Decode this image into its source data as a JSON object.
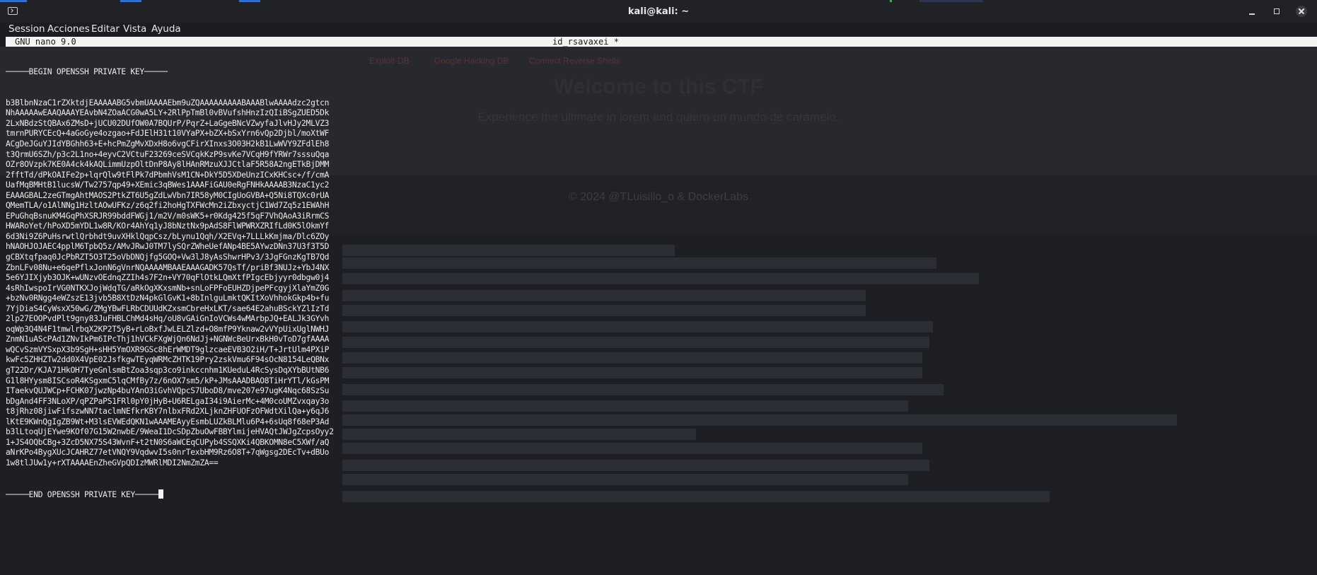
{
  "window": {
    "title": "kali@kali: ~"
  },
  "menu": [
    "Session",
    "Acciones",
    "Editar",
    "Vista",
    "Ayuda"
  ],
  "nano": {
    "version": "GNU nano 9.0",
    "filename": "id_rsavaxei *",
    "begin_line": "─────BEGIN OPENSSH PRIVATE KEY─────",
    "end_line": "─────END OPENSSH PRIVATE KEY─────",
    "key_lines": [
      "b3BlbnNzaC1rZXktdjEAAAAABG5vbmUAAAAEbm9uZQAAAAAAAAABAAABlwAAAAdzc2gtcn",
      "NhAAAAAwEAAQAAAYEAvbN4ZOaACG0wA5LY+2RlPpTmBl0vBVufshHnzIzQIiBSgZUED5Dk",
      "2LxNBdzStQBAx6ZMsD+jUCU02DUfOW0A7BQUrP/PqrZ+LaGgeBNcVZwyfaJlvHJy2MLVZ3",
      "tmrnPURYCEcQ+4aGoGye4ozgao+FdJElH31t10VYaPX+bZX+bSxYrn6vQp2Djbl/moXtWF",
      "ACgDeJGuYJIdYBGhh63+E+hcPmZgMvXDxH8o6vgCFirXInxs3O03H2kB1LwWVY9ZFdlEh8",
      "t3QrmU6SZh/p3c2L1no+4eyvC2VCtuF23269ceSVCqkKzP9svKe7VCqH9fYRWr7sssuQqa",
      "OZr8OVzpk7KE0A4ck4kAQLimmUzpOltDnP8Ay8lHAnRMzuXJJCtlaF5R58A2ngETkBjDMM",
      "2fftTd/dPkOAIFe2p+lqrQlw9tFlPk7dPbmhVsM1CN+DkY5D5XDeUnzICxKHCsc+/f/cmA",
      "UafMqBMHtB1lucsW/Tw2757qp49+XEmic3qBWes1AAAFiGAU0eRgFNHkAAAAB3NzaC1yc2",
      "EAAAGBAL2zeGTmgAhtMAOS2PtkZT6U5gZdLwVbn7IR58yM0CIgUoGVBA+Q5Ni8TQXc0rUA",
      "QMemTLA/o1AlNNg1HzltAOwUFKz/z6q2fi2hoHgTXFWcMn2iZbxyctjC1Wd7Zq5z1EWAhH",
      "EPuGhqBsnuKM4GqPhXSRJR99bddFWGj1/m2V/m0sWK5+r0Kdg425f5qF7VhQAoA3iRrmCS",
      "HWARoYet/hPoXD5mYDL1w8R/KOr4AhYq1yJ8bNztNx9pAdS8FlWPWRXZRIfLd0K5lOkmYf",
      "6d3Ni9Z6PuHsrwtlQrbhdt9uvXHklQqpCsz/bLynu1Qqh/X2EVq+7LLLkKmjma/Dlc6ZOy",
      "hNAOHJOJAEC4pplM6TpbQ5z/AMvJRwJ0TM7lySQrZWheUefANp4BE5AYwzDNn37U3f3T5D",
      "gCBXtqfpaq0JcPbRZT5O3T25oVbDNQjfg5GOQ+Vw3lJ8yAsShwrHPv3/3JgFGnzKgTB7Qd",
      "ZbnLFv08Nu+e6qePflxJonN6gVnrNQAAAAMBAAEAAAGADK57QsTf/priBf3NUJz+YbJ4NX",
      "5e6YJIXjyb3OJK+wUNzvOEdnqZZIh4s7F2n+VY70qFlOtkLQmXtfPIgcEbjyyr0dbgw0j4",
      "4sRhIwspoIrVG0NTKXJojWdqTG/aRkOgXKxsmNb+snLoFPFoEUHZDjpePFcgyjXlaYmZ0G",
      "+bzNv0RNgg4eWZszE13jvb5B8XtDzN4pkGlGvK1+8bInlguLmktQKItXoVhhokGkp4b+fu",
      "7YjDiaS4CyWsxX50wG/ZMgYBwFLRbCDUUdKZxsmCbreHxLKT/sae64E2ahuBSckYZlIzTd",
      "2lp27EOOPvdPlt9gny83JuFHBLChMd4sHq/oU8vGAiGnIoVCWs4wMArbpJQ+EALJk3GYvh",
      "oqWp3Q4N4F1tmwlrbqX2KP2T5yB+rLoBxfJwLELZlzd+O8mfP9Yknaw2vVYpUixUglNWHJ",
      "ZnmN1uAScPAd1ZNvIkPm6IPcThj1hVCkFXgWjQn6NdJj+NGNWcBeUrxBkH0vToD7gfAAAA",
      "wQCvSzmVYSxpX3b9SgH+sHH5YmOXR9GSc8hErWMDT9glzcaeEVB3O2iH/T+JrtUlm4PXiP",
      "kwFc5ZHHZTw2dd0X4VpE02JsfkgwTEyqWRMcZHTK19Pry2zskVmu6F94sOcN8154LeQBNx",
      "gT22Dr/KJA71HkOH7TyeGnlsmBtZoa3sqp3co9inkccnhm1KUeduL4RcSysDqXYbBUtNB6",
      "G1l8HYysm8ISCsoR4KSgxmC5lqCMfBy7z/6nOX7sm5/kP+JMsAAADBAO8TiHrYTl/kGsPM",
      "ITaekvQUJWCp+FCHK07jwzNp4buYAnO3iGvhVQpcS7UboD8/mve207e97ugK4Nqc68SzSu",
      "bDgAnd4FF3NLoXP/qPZPaPS1FRl0pY0jHyB+U6RELgaI34i9AierMc+4M0coUMZvxqay3o",
      "t8jRhz08jiwFifszwNN7taclmNEfkrKBY7nlbxFRd2XLjknZHFUOFzOFWdtXilQa+y6qJ6",
      "lKtE9KWnQgIgZB9Wt+M3lsEVWEdQKN1wAAAMEAyyEsmbLUZkBLMlu6P4+6sUq8f68eP3Ad",
      "b3lLtoqUjEYwe9KOf07G15W2nwbE/9WeaI1DcSDpZbuOwFBBYlmijeHVAQtJWJgZcpsOyy2",
      "1+JS4OQbCBg+3ZcD5NX75S43WvnF+t2tN0S6aWCEqCUPyb4SSQXKi4QBKOMN8eC5XWf/aQ",
      "aNrKPo4BygXUcJCAHRZ77etVNQY9VqdwvI5s0nrTexbHM9Rz6O8T+7qWgsg2DEcTv+dBUo",
      "1w8tlJUw1y+rXTAAAAEnZheGVpQDIzMWRlMDI2NmZmZA=="
    ]
  },
  "background_page": {
    "nav_links": [
      "Exploit-DB",
      "Google Hacking DB",
      "Connect Reverse Shells"
    ],
    "heading": "Welcome to this CTF",
    "subheading": "Experience the ultimate in lorem and quiero un mundo de caramelo.",
    "footer": "© 2024 @TLuisillo_o & DockerLabs"
  },
  "colors": {
    "terminal_bg": "#1c1d22",
    "nano_header_bg": "#f4f4f4",
    "text": "#ececec",
    "accent": "#2e6fd8"
  }
}
